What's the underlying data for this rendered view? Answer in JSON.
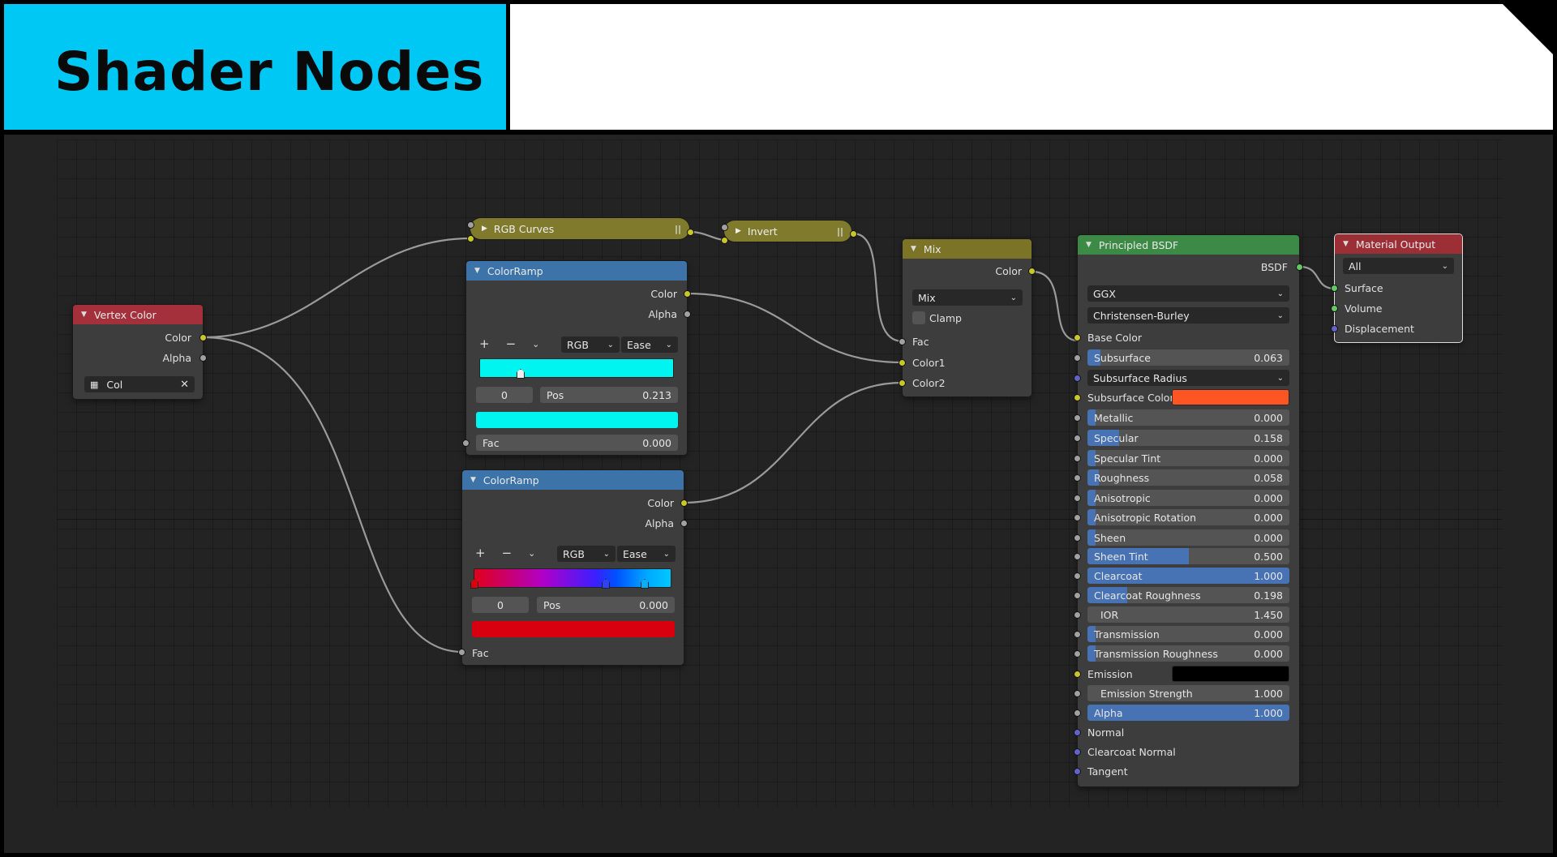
{
  "title": "Shader Nodes",
  "colors": {
    "accent": "#00c8f5",
    "editor_bg": "#232323",
    "socket_color": "#c7c729",
    "socket_float": "#a1a1a1",
    "socket_vector": "#6363c7",
    "socket_shader": "#63c763"
  },
  "vertex_color": {
    "title": "Vertex Color",
    "out_color": "Color",
    "out_alpha": "Alpha",
    "layer": "Col",
    "layer_icon": "vertex-color-icon"
  },
  "rgb_curves": {
    "title": "RGB Curves"
  },
  "invert": {
    "title": "Invert"
  },
  "ramp1": {
    "title": "ColorRamp",
    "out_color": "Color",
    "out_alpha": "Alpha",
    "mode": "RGB",
    "interp": "Ease",
    "index": "0",
    "pos_label": "Pos",
    "pos_value": "0.213",
    "in_fac": "Fac",
    "fac_value": "0.000",
    "stop_color": "#00f5f0",
    "gradient": "#00f5f0"
  },
  "ramp2": {
    "title": "ColorRamp",
    "out_color": "Color",
    "out_alpha": "Alpha",
    "mode": "RGB",
    "interp": "Ease",
    "index": "0",
    "pos_label": "Pos",
    "pos_value": "0.000",
    "in_fac": "Fac",
    "stop_color": "#d8000e"
  },
  "mix": {
    "title": "Mix",
    "out_color": "Color",
    "blend": "Mix",
    "clamp": "Clamp",
    "in_fac": "Fac",
    "in_color1": "Color1",
    "in_color2": "Color2"
  },
  "bsdf": {
    "title": "Principled BSDF",
    "out_bsdf": "BSDF",
    "distribution": "GGX",
    "subsurface_method": "Christensen-Burley",
    "base_color": "Base Color",
    "subsurface": {
      "label": "Subsurface",
      "value": "0.063",
      "fraction": 0.063
    },
    "subsurface_radius": "Subsurface Radius",
    "subsurface_color": {
      "label": "Subsurface Color",
      "color": "#ff5522"
    },
    "metallic": {
      "label": "Metallic",
      "value": "0.000",
      "fraction": 0
    },
    "specular": {
      "label": "Specular",
      "value": "0.158",
      "fraction": 0.158
    },
    "specular_tint": {
      "label": "Specular Tint",
      "value": "0.000",
      "fraction": 0
    },
    "roughness": {
      "label": "Roughness",
      "value": "0.058",
      "fraction": 0.058
    },
    "anisotropic": {
      "label": "Anisotropic",
      "value": "0.000",
      "fraction": 0
    },
    "anisotropic_rotation": {
      "label": "Anisotropic Rotation",
      "value": "0.000",
      "fraction": 0
    },
    "sheen": {
      "label": "Sheen",
      "value": "0.000",
      "fraction": 0
    },
    "sheen_tint": {
      "label": "Sheen Tint",
      "value": "0.500",
      "fraction": 0.5
    },
    "clearcoat": {
      "label": "Clearcoat",
      "value": "1.000",
      "fraction": 1
    },
    "clearcoat_roughness": {
      "label": "Clearcoat Roughness",
      "value": "0.198",
      "fraction": 0.198
    },
    "ior": {
      "label": "IOR",
      "value": "1.450"
    },
    "transmission": {
      "label": "Transmission",
      "value": "0.000",
      "fraction": 0
    },
    "transmission_roughness": {
      "label": "Transmission Roughness",
      "value": "0.000",
      "fraction": 0
    },
    "emission": {
      "label": "Emission",
      "color": "#000000"
    },
    "emission_strength": {
      "label": "Emission Strength",
      "value": "1.000"
    },
    "alpha": {
      "label": "Alpha",
      "value": "1.000",
      "fraction": 1
    },
    "normal": "Normal",
    "clearcoat_normal": "Clearcoat Normal",
    "tangent": "Tangent"
  },
  "material_output": {
    "title": "Material Output",
    "target": "All",
    "surface": "Surface",
    "volume": "Volume",
    "displacement": "Displacement"
  }
}
